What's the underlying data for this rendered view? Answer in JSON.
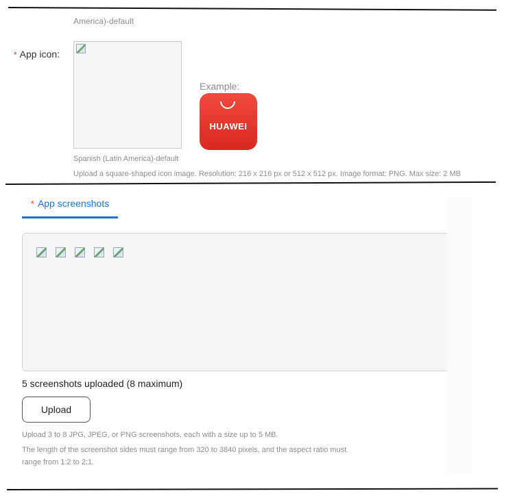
{
  "app_icon_section": {
    "previous_caption": "America)-default",
    "required_marker": "*",
    "label": "App icon:",
    "example_label": "Example:",
    "example_brand": "HUAWEI",
    "icon_caption": "Spanish (Latin America)-default",
    "hint": "Upload a square-shaped icon image. Resolution: 216 x 216 px or 512 x 512 px. Image format: PNG. Max size: 2 MB",
    "icon_uploader_image": "broken-image-icon",
    "example_icon_color": "#e8352c"
  },
  "screenshots_section": {
    "tab": {
      "required_marker": "*",
      "label": "App screenshots",
      "active_color": "#1a73d9"
    },
    "thumbnails": [
      "broken-image-icon",
      "broken-image-icon",
      "broken-image-icon",
      "broken-image-icon",
      "broken-image-icon"
    ],
    "count_text": "5 screenshots uploaded (8 maximum)",
    "upload_button": "Upload",
    "hint_formats": "Upload 3 to 8 JPG, JPEG, or PNG screenshots, each with a size up to 5 MB.",
    "hint_dimensions": "The length of the screenshot sides must range from 320 to 3840 pixels, and the aspect ratio must range from 1:2 to 2:1."
  }
}
